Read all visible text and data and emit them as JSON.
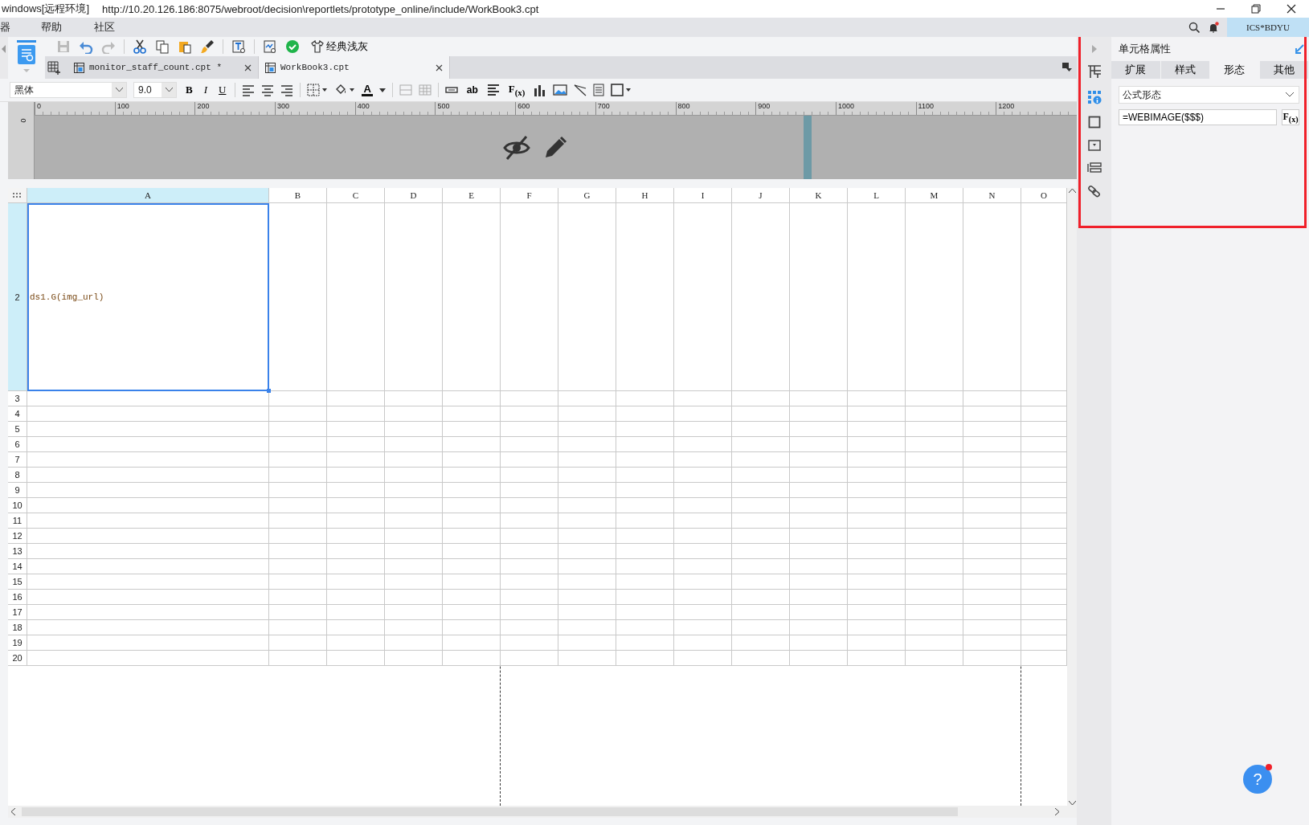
{
  "window": {
    "title": "windows[远程环境]",
    "url": "http://10.20.126.186:8075/webroot/decision\\reportlets/prototype_online/include/WorkBook3.cpt"
  },
  "menu": [
    "器",
    "帮助",
    "社区"
  ],
  "user_badge": "ICS*BDYU",
  "toolbar": {
    "theme_button": "经典浅灰"
  },
  "file_tabs": [
    {
      "label": "monitor_staff_count.cpt *",
      "selected": false
    },
    {
      "label": "WorkBook3.cpt",
      "selected": true
    }
  ],
  "format_bar": {
    "font": "黑体",
    "size": "9.0",
    "style_buttons": [
      "B",
      "I",
      "U"
    ],
    "font_color": "A",
    "text_tools": [
      "ab",
      "F$_{(x)}$"
    ]
  },
  "ruler": {
    "vertical_label": "0",
    "ticks": [
      "0",
      "100",
      "200",
      "300",
      "400",
      "500",
      "600",
      "700",
      "800",
      "900",
      "1000",
      "1100",
      "1200"
    ]
  },
  "grid": {
    "columns": [
      {
        "label": "A",
        "selected": true
      },
      {
        "label": "B",
        "selected": false
      },
      {
        "label": "C",
        "selected": false
      },
      {
        "label": "D",
        "selected": false
      },
      {
        "label": "E",
        "selected": false
      },
      {
        "label": "F",
        "selected": false
      },
      {
        "label": "G",
        "selected": false
      },
      {
        "label": "H",
        "selected": false
      },
      {
        "label": "I",
        "selected": false
      },
      {
        "label": "J",
        "selected": false
      },
      {
        "label": "K",
        "selected": false
      },
      {
        "label": "L",
        "selected": false
      },
      {
        "label": "M",
        "selected": false
      },
      {
        "label": "N",
        "selected": false
      },
      {
        "label": "O",
        "selected": false
      }
    ],
    "rows": [
      {
        "label": "2",
        "selected": true
      },
      {
        "label": "3",
        "selected": false
      },
      {
        "label": "4",
        "selected": false
      },
      {
        "label": "5",
        "selected": false
      },
      {
        "label": "6",
        "selected": false
      },
      {
        "label": "7",
        "selected": false
      },
      {
        "label": "8",
        "selected": false
      },
      {
        "label": "9",
        "selected": false
      },
      {
        "label": "10",
        "selected": false
      },
      {
        "label": "11",
        "selected": false
      },
      {
        "label": "12",
        "selected": false
      },
      {
        "label": "13",
        "selected": false
      },
      {
        "label": "14",
        "selected": false
      },
      {
        "label": "15",
        "selected": false
      },
      {
        "label": "16",
        "selected": false
      },
      {
        "label": "17",
        "selected": false
      },
      {
        "label": "18",
        "selected": false
      },
      {
        "label": "19",
        "selected": false
      },
      {
        "label": "20",
        "selected": false
      }
    ],
    "active_cell": "ds1.G(img_url)"
  },
  "panel": {
    "title": "单元格属性",
    "tabs": [
      {
        "label": "扩展",
        "selected": false
      },
      {
        "label": "样式",
        "selected": false
      },
      {
        "label": "形态",
        "selected": true
      },
      {
        "label": "其他",
        "selected": false
      }
    ],
    "form_type": "公式形态",
    "formula": "=WEBIMAGE($$$)",
    "formula_button": "F$_{(x)}$"
  },
  "help_button": "?"
}
